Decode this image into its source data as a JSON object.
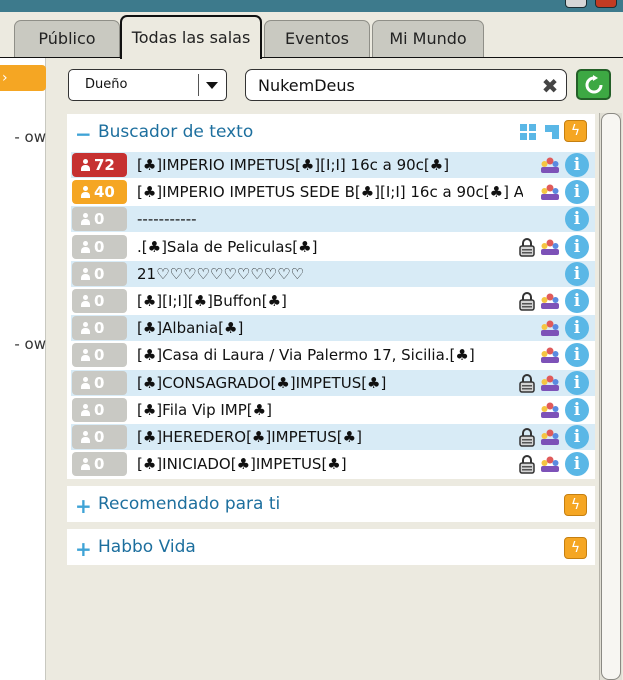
{
  "tabs": [
    {
      "label": "Público",
      "active": false
    },
    {
      "label": "Todas las salas",
      "active": true
    },
    {
      "label": "Eventos",
      "active": false
    },
    {
      "label": "Mi Mundo",
      "active": false
    }
  ],
  "left_panel": {
    "fragments": [
      "- ow",
      "- ow"
    ]
  },
  "filter": {
    "selected": "Dueño"
  },
  "search": {
    "value": "NukemDeus"
  },
  "sections": [
    {
      "title": "Buscador de texto",
      "expanded": true,
      "rooms": [
        {
          "count": "72",
          "color": "red",
          "name": "[♣]IMPERIO IMPETUS[♣][I;I] 16c a 90c[♣]",
          "locked": false
        },
        {
          "count": "40",
          "color": "orange",
          "name": "[♣]IMPERIO IMPETUS SEDE B[♣][I;I] 16c a 90c[♣] A",
          "locked": false
        },
        {
          "count": "0",
          "color": "gray",
          "name": "-----------",
          "locked": false,
          "no_group": true
        },
        {
          "count": "0",
          "color": "gray",
          "name": ".[♣]Sala de Peliculas[♣]",
          "locked": true
        },
        {
          "count": "0",
          "color": "gray",
          "name": "21♡♡♡♡♡♡♡♡♡♡♡",
          "locked": false,
          "no_group": true
        },
        {
          "count": "0",
          "color": "gray",
          "name": "[♣][I;I][♣]Buffon[♣]",
          "locked": true
        },
        {
          "count": "0",
          "color": "gray",
          "name": "[♣]Albania[♣]",
          "locked": false
        },
        {
          "count": "0",
          "color": "gray",
          "name": "[♣]Casa di Laura / Via Palermo 17, Sicilia.[♣]",
          "locked": false
        },
        {
          "count": "0",
          "color": "gray",
          "name": "[♣]CONSAGRADO[♣]IMPETUS[♣]",
          "locked": true
        },
        {
          "count": "0",
          "color": "gray",
          "name": "[♣]Fila Vip IMP[♣]",
          "locked": false
        },
        {
          "count": "0",
          "color": "gray",
          "name": "[♣]HEREDERO[♣]IMPETUS[♣]",
          "locked": true
        },
        {
          "count": "0",
          "color": "gray",
          "name": "[♣]INICIADO[♣]IMPETUS[♣]",
          "locked": true
        }
      ]
    },
    {
      "title": "Recomendado para ti",
      "expanded": false
    },
    {
      "title": "Habbo Vida",
      "expanded": false
    }
  ],
  "icons": {
    "toggle_expanded": "−",
    "toggle_collapsed": "+",
    "bolt": "ϟ",
    "clear": "✖",
    "info": "i"
  },
  "colors": {
    "accent_blue": "#1d6f9e",
    "badge_red": "#c63131",
    "badge_orange": "#f5a623",
    "badge_gray": "#c9c9c4",
    "row_alt": "#d8ebf6",
    "refresh_green": "#3da843"
  }
}
